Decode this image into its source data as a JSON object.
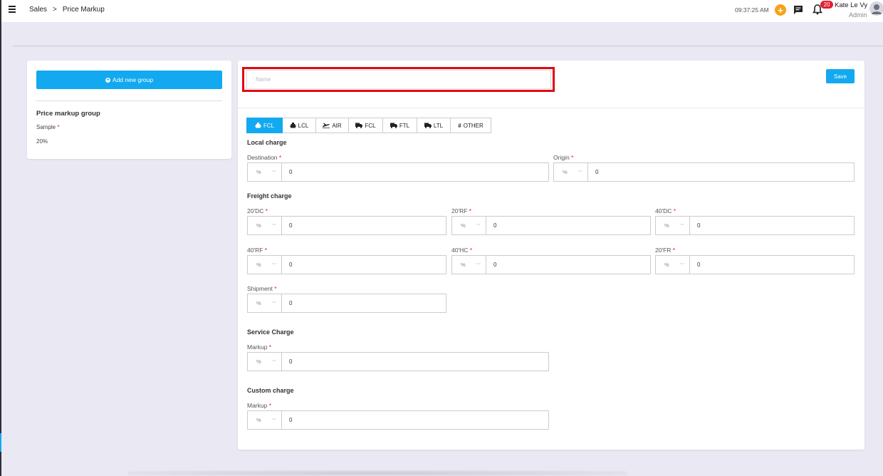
{
  "breadcrumb": {
    "root": "Sales",
    "separator": ">",
    "current": "Price Markup"
  },
  "header": {
    "time": "09:37:25 AM",
    "notifications_count": "20",
    "user_name": "Kate Le Vy",
    "user_role": "Admin"
  },
  "sidebar_panel": {
    "add_group_label": "Add new group",
    "group_title": "Price markup group",
    "group_item": "Sample",
    "group_value": "20%"
  },
  "form": {
    "name_placeholder": "Name",
    "save_label": "Save",
    "tabs": [
      {
        "label": "FCL",
        "icon": "ship-icon",
        "active": true
      },
      {
        "label": "LCL",
        "icon": "ship-icon",
        "active": false
      },
      {
        "label": "AIR",
        "icon": "plane-icon",
        "active": false
      },
      {
        "label": "FCL",
        "icon": "truck-icon",
        "active": false
      },
      {
        "label": "FTL",
        "icon": "truck-icon",
        "active": false
      },
      {
        "label": "LTL",
        "icon": "truck-icon",
        "active": false
      },
      {
        "label": "OTHER",
        "icon": "hash-icon",
        "active": false
      }
    ],
    "unit_option": "%",
    "local_charge": {
      "title": "Local charge",
      "destination": {
        "label": "Destination",
        "value": "0"
      },
      "origin": {
        "label": "Origin",
        "value": "0"
      }
    },
    "freight_charge": {
      "title": "Freight charge",
      "dc20": {
        "label": "20'DC",
        "value": "0"
      },
      "rf20": {
        "label": "20'RF",
        "value": "0"
      },
      "dc40": {
        "label": "40'DC",
        "value": "0"
      },
      "rf40": {
        "label": "40'RF",
        "value": "0"
      },
      "hc40": {
        "label": "40'HC",
        "value": "0"
      },
      "fr20": {
        "label": "20'FR",
        "value": "0"
      },
      "shipment": {
        "label": "Shipment",
        "value": "0"
      }
    },
    "service_charge": {
      "title": "Service Charge",
      "markup": {
        "label": "Markup",
        "value": "0"
      }
    },
    "custom_charge": {
      "title": "Custom charge",
      "markup": {
        "label": "Markup",
        "value": "0"
      }
    }
  },
  "colors": {
    "accent": "#12a9f0",
    "required": "#e0202e",
    "highlight": "#e30613",
    "orange": "#f7a21b"
  }
}
